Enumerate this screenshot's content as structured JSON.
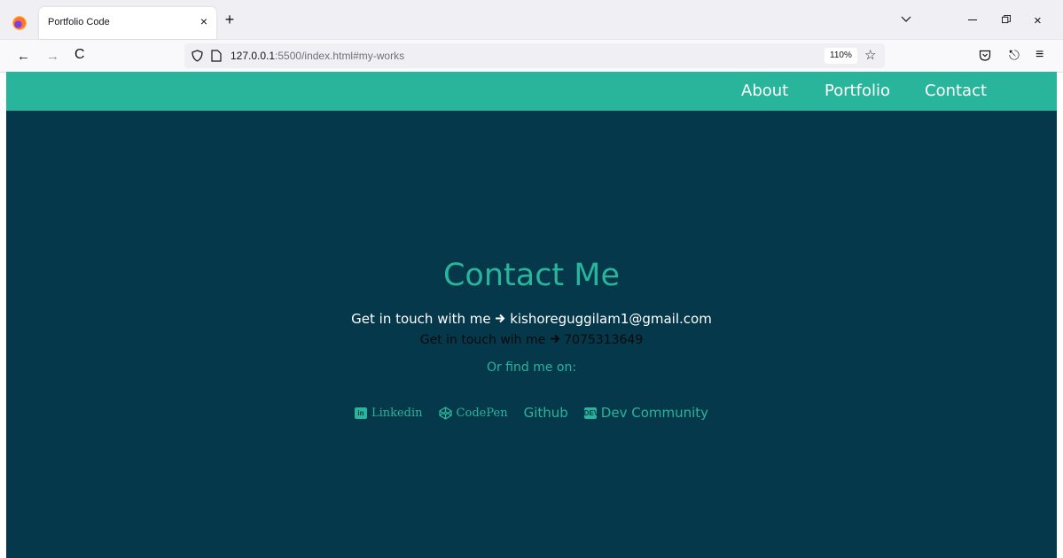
{
  "browser": {
    "tab_title": "Portfolio Code",
    "tab_close": "×",
    "new_tab": "+",
    "url_host": "127.0.0.1",
    "url_rest": ":5500/index.html#my-works",
    "zoom": "110%",
    "icons": {
      "back": "←",
      "forward": "→",
      "reload": "C",
      "star": "☆",
      "share": "⎋",
      "menu": "≡",
      "tab_list": "chevron-down-icon",
      "close": "×"
    }
  },
  "site": {
    "nav": [
      "About",
      "Portfolio",
      "Contact"
    ],
    "contact": {
      "title": "Contact Me",
      "email_prefix": "Get in touch with me",
      "email": "kishoreguggilam1@gmail.com",
      "phone_prefix": "Get in touch wih me",
      "phone": "7075313649",
      "find_me": "Or find me on:"
    },
    "socials": [
      {
        "label": "Linkedin",
        "icon": "linkedin-icon"
      },
      {
        "label": "CodePen",
        "icon": "codepen-icon"
      },
      {
        "label": "Github",
        "icon": ""
      },
      {
        "label": "Dev Community",
        "icon": "dev-icon"
      }
    ],
    "colors": {
      "header": "#28b59b",
      "background": "#05384a",
      "accent": "#28b59b"
    }
  }
}
